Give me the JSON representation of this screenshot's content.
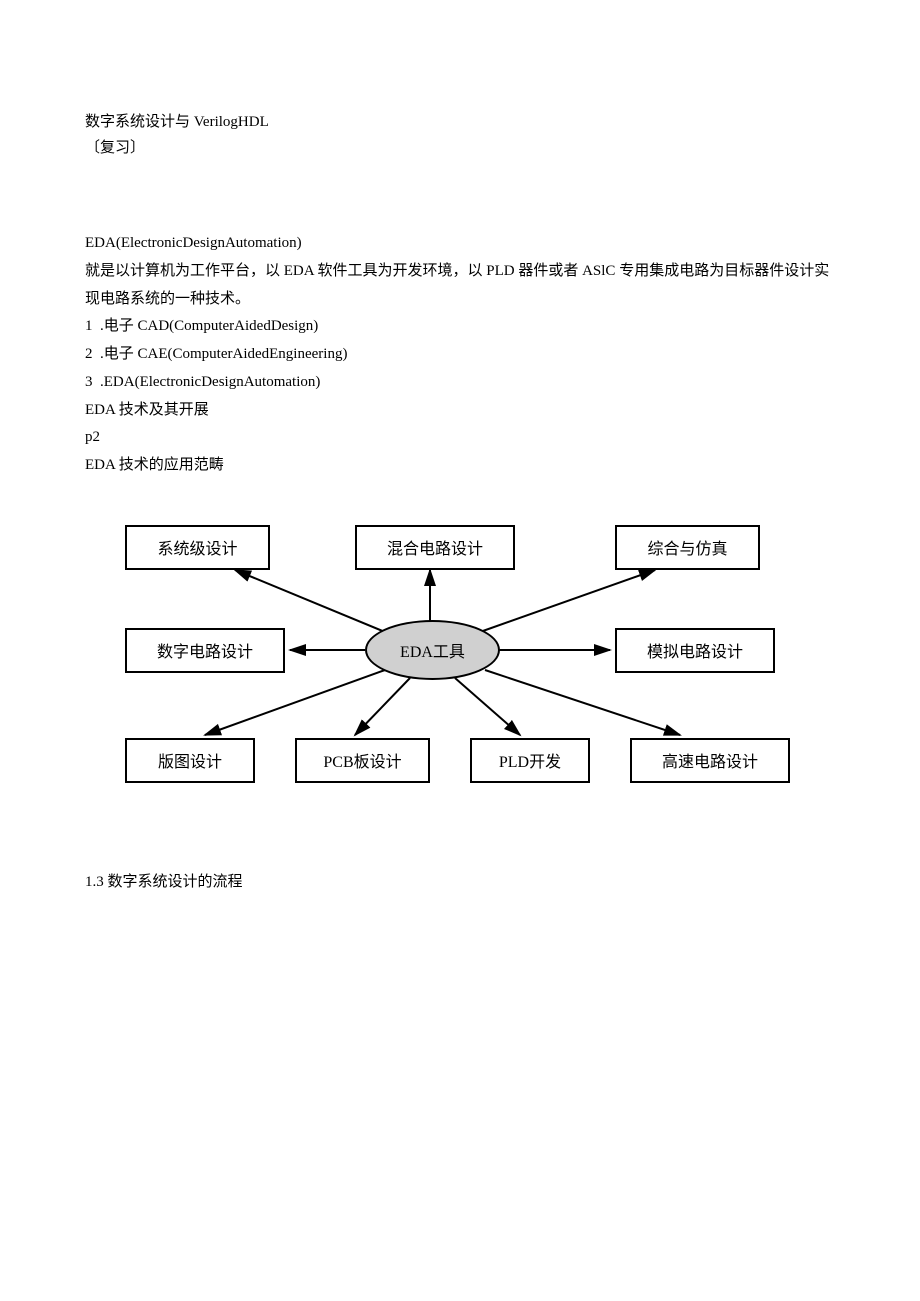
{
  "header": {
    "title": "数字系统设计与 VerilogHDL",
    "subtitle": "〔复习〕"
  },
  "section1": {
    "eda_heading": "EDA(ElectronicDesignAutomation)",
    "eda_def": "就是以计算机为工作平台，以 EDA 软件工具为开发环境，以 PLD 器件或者 ASlC 专用集成电路为目标器件设计实现电路系统的一种技术。",
    "list": [
      {
        "num": "1",
        "text": ".电子 CAD(ComputerAidedDesign)"
      },
      {
        "num": "2",
        "text": ".电子 CAE(ComputerAidedEngineering)"
      },
      {
        "num": "3",
        "text": ".EDA(ElectronicDesignAutomation)"
      }
    ],
    "line_dev": "EDA 技术及其开展",
    "line_p2": "p2",
    "line_scope": "EDA 技术的应用范畴"
  },
  "diagram": {
    "center": "EDA工具",
    "nodes": {
      "top_left": "系统级设计",
      "top_mid": "混合电路设计",
      "top_right": "综合与仿真",
      "mid_left": "数字电路设计",
      "mid_right": "模拟电路设计",
      "bot_1": "版图设计",
      "bot_2": "PCB板设计",
      "bot_3": "PLD开发",
      "bot_4": "高速电路设计"
    }
  },
  "section2": {
    "heading": "1.3 数字系统设计的流程"
  }
}
